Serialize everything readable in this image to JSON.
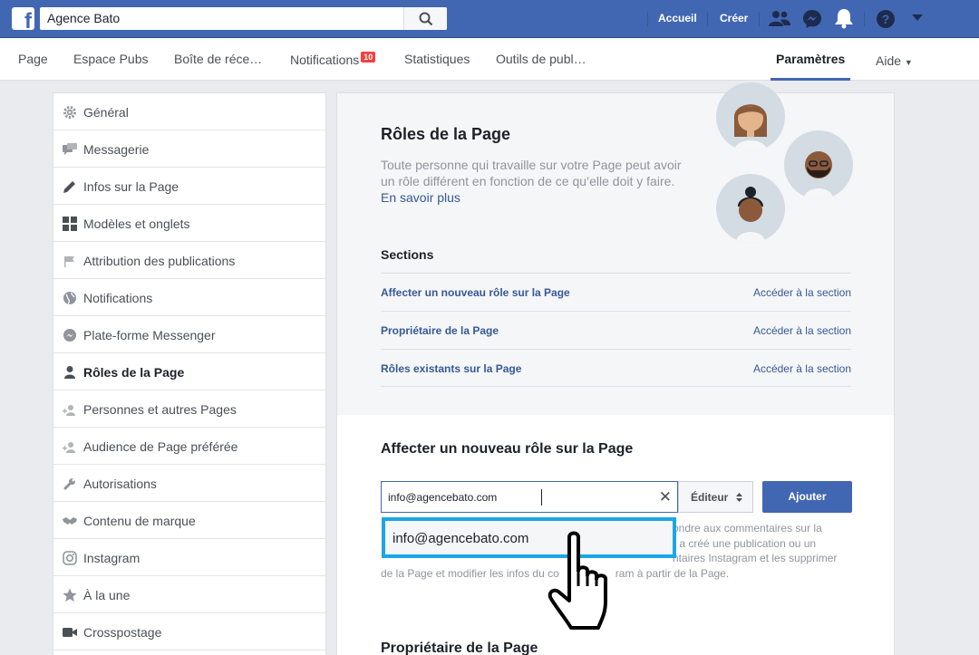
{
  "topbar": {
    "search_value": "Agence Bato",
    "links": [
      "Accueil",
      "Créer"
    ],
    "icons": [
      "friends-icon",
      "messenger-icon",
      "bell-icon",
      "help-icon",
      "caret-down-icon"
    ],
    "brand_color": "#4267b2"
  },
  "tabs": [
    {
      "label": "Page"
    },
    {
      "label": "Espace Pubs"
    },
    {
      "label": "Boîte de réce…"
    },
    {
      "label": "Notifications",
      "badge": "10"
    },
    {
      "label": "Statistiques"
    },
    {
      "label": "Outils de publ…"
    },
    {
      "label": "Paramètres",
      "active": true
    },
    {
      "label": "Aide"
    }
  ],
  "sidebar": {
    "items": [
      {
        "label": "Général",
        "icon": "gear-icon"
      },
      {
        "label": "Messagerie",
        "icon": "chat-icon"
      },
      {
        "label": "Infos sur la Page",
        "icon": "pencil-icon"
      },
      {
        "label": "Modèles et onglets",
        "icon": "grid-icon"
      },
      {
        "label": "Attribution des publications",
        "icon": "flag-icon"
      },
      {
        "label": "Notifications",
        "icon": "globe-icon"
      },
      {
        "label": "Plate-forme Messenger",
        "icon": "messenger-icon"
      },
      {
        "label": "Rôles de la Page",
        "icon": "person-icon",
        "active": true
      },
      {
        "label": "Personnes et autres Pages",
        "icon": "person-plus-icon"
      },
      {
        "label": "Audience de Page préférée",
        "icon": "person-plus-icon"
      },
      {
        "label": "Autorisations",
        "icon": "wrench-icon"
      },
      {
        "label": "Contenu de marque",
        "icon": "handshake-icon"
      },
      {
        "label": "Instagram",
        "icon": "instagram-icon"
      },
      {
        "label": "À la une",
        "icon": "star-icon"
      },
      {
        "label": "Crosspostage",
        "icon": "video-icon"
      }
    ]
  },
  "main": {
    "title": "Rôles de la Page",
    "description": "Toute personne qui travaille sur votre Page peut avoir un rôle différent en fonction de ce qu’elle doit y faire.",
    "learn_more": "En savoir plus",
    "sections_title": "Sections",
    "sections": [
      {
        "label": "Affecter un nouveau rôle sur la Page",
        "link": "Accéder à la section"
      },
      {
        "label": "Propriétaire de la Page",
        "link": "Accéder à la section"
      },
      {
        "label": "Rôles existants sur la Page",
        "link": "Accéder à la section"
      }
    ],
    "assign_title": "Affecter un nouveau rôle sur la Page",
    "email_value": "info@agencebato.com",
    "role_value": "Éditeur",
    "add_label": "Ajouter",
    "help_text_lines": [
      "ondre aux commentaires sur la",
      "r a créé une publication ou un",
      "ntaires Instagram et les supprimer",
      "de la Page et modifier les infos du co",
      "ram à partir de la Page."
    ],
    "suggestion": "info@agencebato.com",
    "owner_title": "Propriétaire de la Page"
  }
}
